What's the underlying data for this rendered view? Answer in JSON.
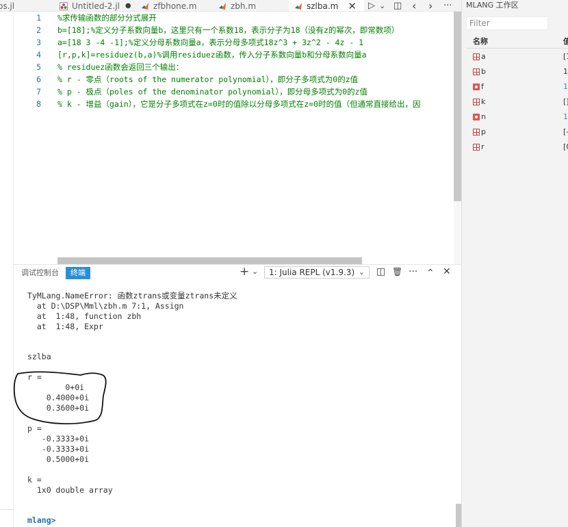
{
  "tabs": [
    {
      "label": "os.jl",
      "icon": "none",
      "active": false
    },
    {
      "label": "Untitled-2.jl",
      "icon": "julia-file-icon",
      "modified_marker": "●",
      "active": false
    },
    {
      "label": "zfbhone.m",
      "icon": "matlab-file-icon",
      "active": false
    },
    {
      "label": "zbh.m",
      "icon": "matlab-file-icon",
      "active": false
    },
    {
      "label": "szlba.m",
      "icon": "matlab-file-icon",
      "close": "✕",
      "active": true
    }
  ],
  "tab_toolbar": {
    "run": "▷",
    "run_dropdown": "⌄",
    "split": "◫",
    "back": "‹",
    "forward": "›",
    "more": "···"
  },
  "editor": {
    "lines": [
      {
        "num": "1",
        "text": "%求传输函数的部分分式展开"
      },
      {
        "num": "2",
        "text": "b=[18];%定义分子系数向量b，这里只有一个系数18，表示分子为18（没有z的幂次，即常数项）"
      },
      {
        "num": "3",
        "text": "a=[18 3 -4 -1];%定义分母系数向量a，表示分母多项式18z^3 + 3z^2 - 4z - 1"
      },
      {
        "num": "4",
        "text": "[r,p,k]=residuez(b,a)%调用residuez函数，传入分子系数向量b和分母系数向量a"
      },
      {
        "num": "5",
        "text": "% residuez函数会返回三个输出："
      },
      {
        "num": "6",
        "text": "% r - 零点（roots of the numerator polynomial），即分子多项式为0的z值"
      },
      {
        "num": "7",
        "text": "% p - 极点（poles of the denominator polynomial），即分母多项式为0的z值"
      },
      {
        "num": "8",
        "text": "% k - 增益（gain），它是分子多项式在z=0时的值除以分母多项式在z=0时的值（但通常直接给出，因"
      }
    ]
  },
  "panel": {
    "tab_debug_console": "调试控制台",
    "tab_terminal": "终端",
    "add": "+",
    "add_dropdown": "⌄",
    "terminal_select": "1: Julia REPL (v1.9.3)",
    "terminal_select_chevron": "⌄",
    "split": "◫",
    "trash": "🗑",
    "more": "···",
    "maximize": "⌃",
    "close": "✕"
  },
  "terminal": {
    "lines": [
      "TyMLang.NameError: 函数ztrans或变量ztrans未定义",
      "  at D:\\DSP\\Mml\\zbh.m 7:1, Assign",
      "  at  1:48, function zbh",
      "  at  1:48, Expr",
      "szlba",
      "r =",
      "        0+0i",
      "    0.4000+0i",
      "    0.3600+0i",
      "p =",
      "   -0.3333+0i",
      "   -0.3333+0i",
      "    0.5000+0i",
      "k =",
      "  1x0 double array"
    ],
    "prompt": "mlang>"
  },
  "workspace": {
    "title": "MLANG 工作区",
    "filter_placeholder": "Filter",
    "col_name": "名称",
    "col_value": "值",
    "variables": [
      {
        "name": "a",
        "icon": "grid-icon",
        "value": "[1"
      },
      {
        "name": "b",
        "icon": "grid-icon",
        "value": "1"
      },
      {
        "name": "f",
        "icon": "function-icon",
        "value": "1"
      },
      {
        "name": "k",
        "icon": "grid-icon",
        "value": "[]"
      },
      {
        "name": "n",
        "icon": "function-icon",
        "value": "1"
      },
      {
        "name": "p",
        "icon": "grid-icon",
        "value": "[-"
      },
      {
        "name": "r",
        "icon": "grid-icon",
        "value": "[0"
      }
    ]
  },
  "colors": {
    "comment_green": "#008000",
    "line_number": "#237893",
    "terminal_tab_active": "#2b8fd6",
    "prompt": "#1f6fb2",
    "grid_icon": "#c94040",
    "function_icon": "#e05555"
  }
}
